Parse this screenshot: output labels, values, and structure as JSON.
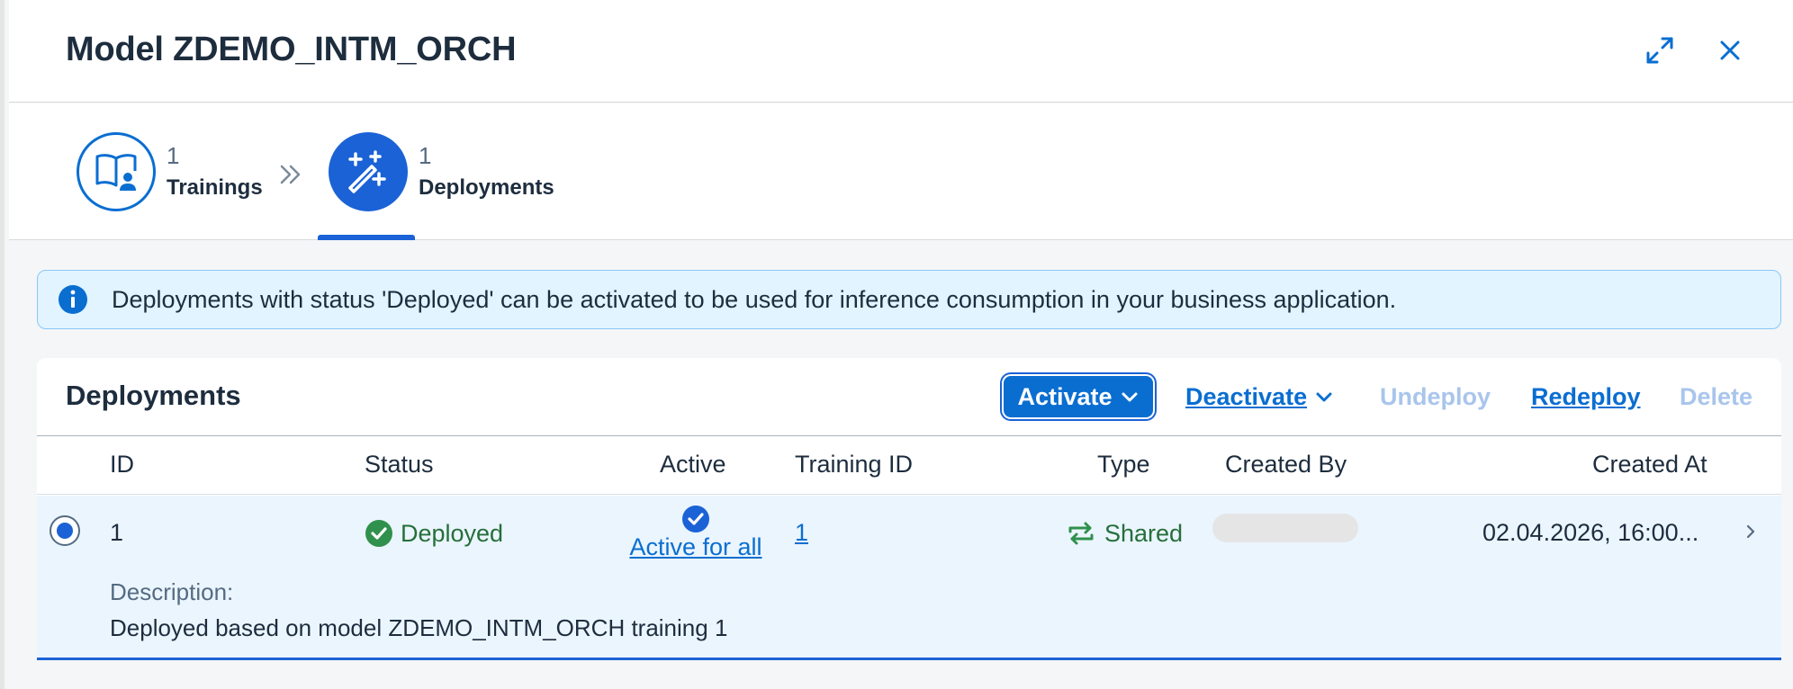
{
  "dialog": {
    "title": "Model ZDEMO_INTM_ORCH"
  },
  "colors": {
    "brand": "#0a6ed1",
    "success": "#256f3a",
    "info_bg": "#e1f4ff"
  },
  "steps": [
    {
      "count": "1",
      "label": "Trainings",
      "icon": "book-person-icon"
    },
    {
      "count": "1",
      "label": "Deployments",
      "icon": "magic-wand-icon"
    }
  ],
  "info": {
    "text": "Deployments with status 'Deployed' can be activated to be used for inference consumption in your business application."
  },
  "table": {
    "title": "Deployments",
    "toolbar": {
      "activate": "Activate",
      "deactivate": "Deactivate",
      "undeploy": "Undeploy",
      "redeploy": "Redeploy",
      "delete": "Delete"
    },
    "columns": {
      "id": "ID",
      "status": "Status",
      "active": "Active",
      "training_id": "Training ID",
      "type": "Type",
      "created_by": "Created By",
      "created_at": "Created At"
    },
    "rows": [
      {
        "id": "1",
        "status": "Deployed",
        "active": "Active for all",
        "training_id": "1",
        "type": "Shared",
        "created_at": "02.04.2026, 16:00...",
        "description_label": "Description:",
        "description": "Deployed based on model ZDEMO_INTM_ORCH training 1"
      }
    ]
  }
}
